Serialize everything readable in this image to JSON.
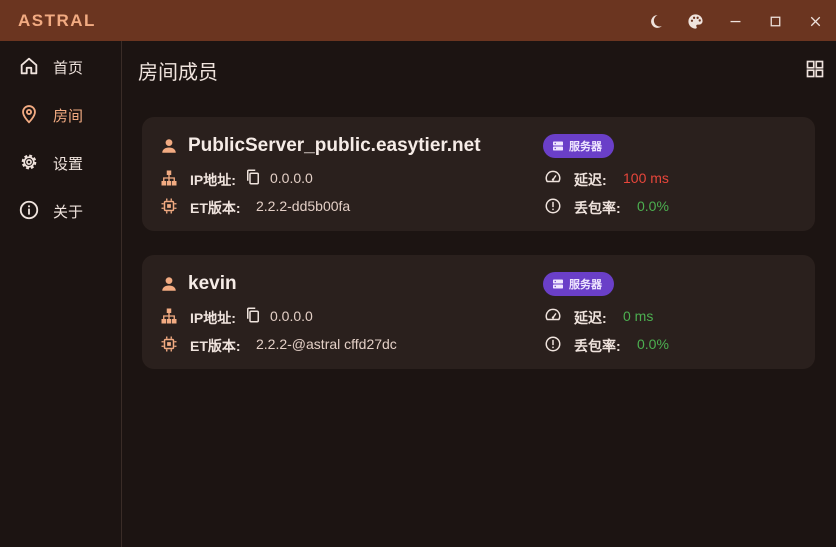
{
  "app": {
    "name": "ASTRAL"
  },
  "colors": {
    "accent": "#f2ab82",
    "titlebar": "#6b3520",
    "badge": "#6a3fc8",
    "bad": "#e8463b",
    "good": "#4caf50"
  },
  "window_controls": [
    {
      "icon": "moon-icon"
    },
    {
      "icon": "palette-icon"
    },
    {
      "icon": "minimize-icon"
    },
    {
      "icon": "maximize-icon"
    },
    {
      "icon": "close-icon"
    }
  ],
  "sidebar": {
    "items": [
      {
        "label": "首页",
        "icon": "home-icon"
      },
      {
        "label": "房间",
        "icon": "location-pin-icon",
        "active": true
      },
      {
        "label": "设置",
        "icon": "gear-icon"
      },
      {
        "label": "关于",
        "icon": "info-icon"
      }
    ]
  },
  "page": {
    "title": "房间成员"
  },
  "members": [
    {
      "name": "PublicServer_public.easytier.net",
      "badge": "服务器",
      "ip_label": "IP地址:",
      "ip": "0.0.0.0",
      "version_label": "ET版本:",
      "version": "2.2.2-dd5b00fa",
      "latency_label": "延迟:",
      "latency": "100 ms",
      "latency_color": "#e8463b",
      "loss_label": "丢包率:",
      "loss": "0.0%",
      "loss_color": "#4caf50"
    },
    {
      "name": "kevin",
      "badge": "服务器",
      "ip_label": "IP地址:",
      "ip": "0.0.0.0",
      "version_label": "ET版本:",
      "version": "2.2.2-@astral cffd27dc",
      "latency_label": "延迟:",
      "latency": "0 ms",
      "latency_color": "#4caf50",
      "loss_label": "丢包率:",
      "loss": "0.0%",
      "loss_color": "#4caf50"
    }
  ]
}
